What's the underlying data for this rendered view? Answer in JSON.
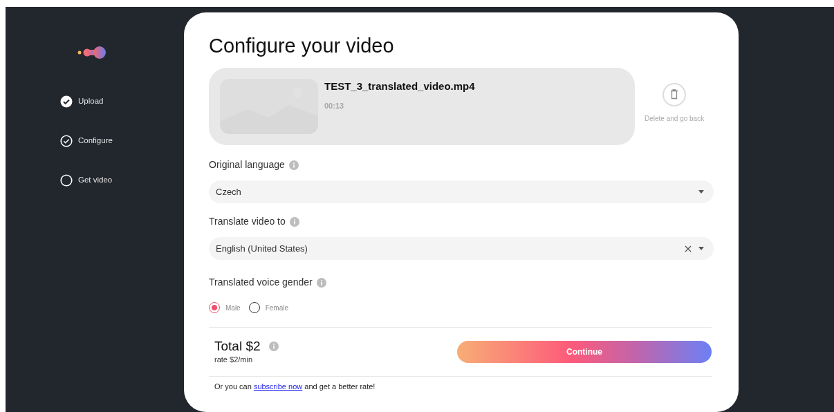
{
  "steps": [
    {
      "label": "Upload",
      "kind": "done"
    },
    {
      "label": "Configure",
      "kind": "current"
    },
    {
      "label": "Get video",
      "kind": "todo"
    }
  ],
  "title": "Configure your video",
  "video": {
    "file_name": "TEST_3_translated_video.mp4",
    "duration": "00:13",
    "delete_label": "Delete and go back"
  },
  "original_language": {
    "label": "Original language",
    "value": "Czech",
    "clearable": false
  },
  "translate_to": {
    "label": "Translate video to",
    "value": "English (United States)",
    "clearable": true
  },
  "voice_gender": {
    "label": "Translated voice gender",
    "options": [
      {
        "label": "Male",
        "selected": true
      },
      {
        "label": "Female",
        "selected": false
      }
    ]
  },
  "total": {
    "amount": "Total $2",
    "rate": "rate $2/min"
  },
  "continue_button": "Continue",
  "note": {
    "before": "Or you can",
    "link": "subscribe now",
    "after": "and get a better rate!"
  }
}
